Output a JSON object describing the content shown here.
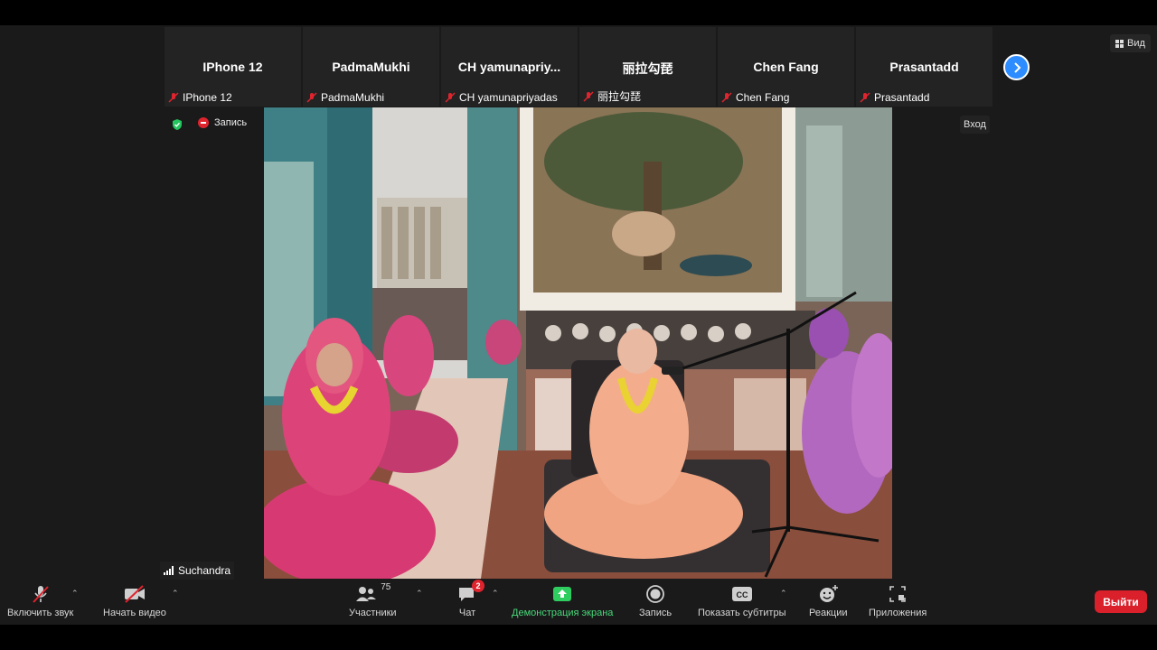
{
  "participants": [
    {
      "name": "IPhone 12",
      "label": "IPhone 12"
    },
    {
      "name": "PadmaMukhi",
      "label": "PadmaMukhi"
    },
    {
      "name": "CH yamunapriy...",
      "label": "CH yamunapriyadas"
    },
    {
      "name": "丽拉勾琵",
      "label": "丽拉勾琵"
    },
    {
      "name": "Chen Fang",
      "label": "Chen Fang"
    },
    {
      "name": "Prasantadd",
      "label": "Prasantadd"
    }
  ],
  "view_label": "Вид",
  "recording_label": "Запись",
  "login_label": "Вход",
  "active_speaker": "Suchandra",
  "toolbar": {
    "mute_label": "Включить звук",
    "video_label": "Начать видео",
    "participants_label": "Участники",
    "participants_count": "75",
    "chat_label": "Чат",
    "chat_badge": "2",
    "share_label": "Демонстрация экрана",
    "record_label": "Запись",
    "cc_text": "CC",
    "subtitles_label": "Показать субтитры",
    "reactions_label": "Реакции",
    "apps_label": "Приложения",
    "leave_label": "Выйти"
  },
  "colors": {
    "accent_blue": "#2d8cff",
    "leave_red": "#d9202b",
    "share_green": "#48d97a",
    "record_red": "#e0242e"
  }
}
